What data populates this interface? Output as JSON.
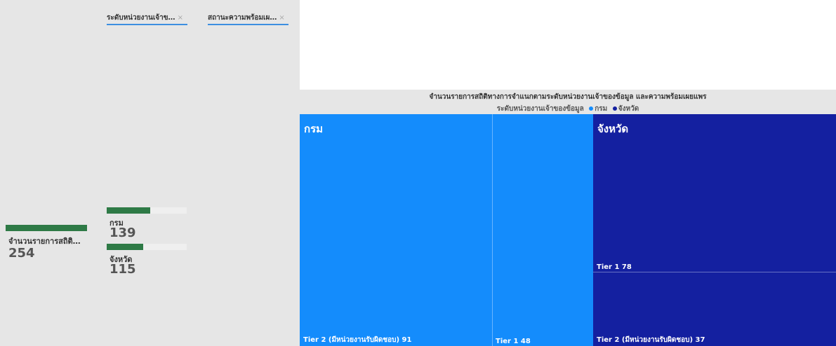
{
  "filters": [
    {
      "label": "ระดับหน่วยงานเจ้าข…",
      "close": "×"
    },
    {
      "label": "สถานะความพร้อมเผ…",
      "close": "×"
    }
  ],
  "total_card": {
    "label": "จำนวนรายการสถิติ…",
    "value": "254"
  },
  "breakdown": [
    {
      "label": "กรม",
      "value": "139",
      "fraction": 0.547
    },
    {
      "label": "จังหวัด",
      "value": "115",
      "fraction": 0.453
    }
  ],
  "colors": {
    "krom": "#148cfc",
    "changwat": "#1420a0",
    "bar": "#2e7a46"
  },
  "chart_data": {
    "type": "treemap",
    "title": "จำนวนรายการสถิติทางการจำแนกตามระดับหน่วยงานเจ้าของข้อมูล และความพร้อมเผยแพร",
    "legend_title": "ระดับหน่วยงานเจ้าของข้อมูล",
    "legend": [
      {
        "label": "กรม",
        "color": "#148cfc"
      },
      {
        "label": "จังหวัด",
        "color": "#1420a0"
      }
    ],
    "groups": [
      {
        "name": "กรม",
        "color": "#148cfc",
        "items": [
          {
            "label": "Tier 2 (มีหน่วยงานรับผิดชอบ)",
            "value": 91
          },
          {
            "label": "Tier 1",
            "value": 48
          }
        ]
      },
      {
        "name": "จังหวัด",
        "color": "#1420a0",
        "items": [
          {
            "label": "Tier 1",
            "value": 78
          },
          {
            "label": "Tier 2 (มีหน่วยงานรับผิดชอบ)",
            "value": 37
          }
        ]
      }
    ]
  }
}
